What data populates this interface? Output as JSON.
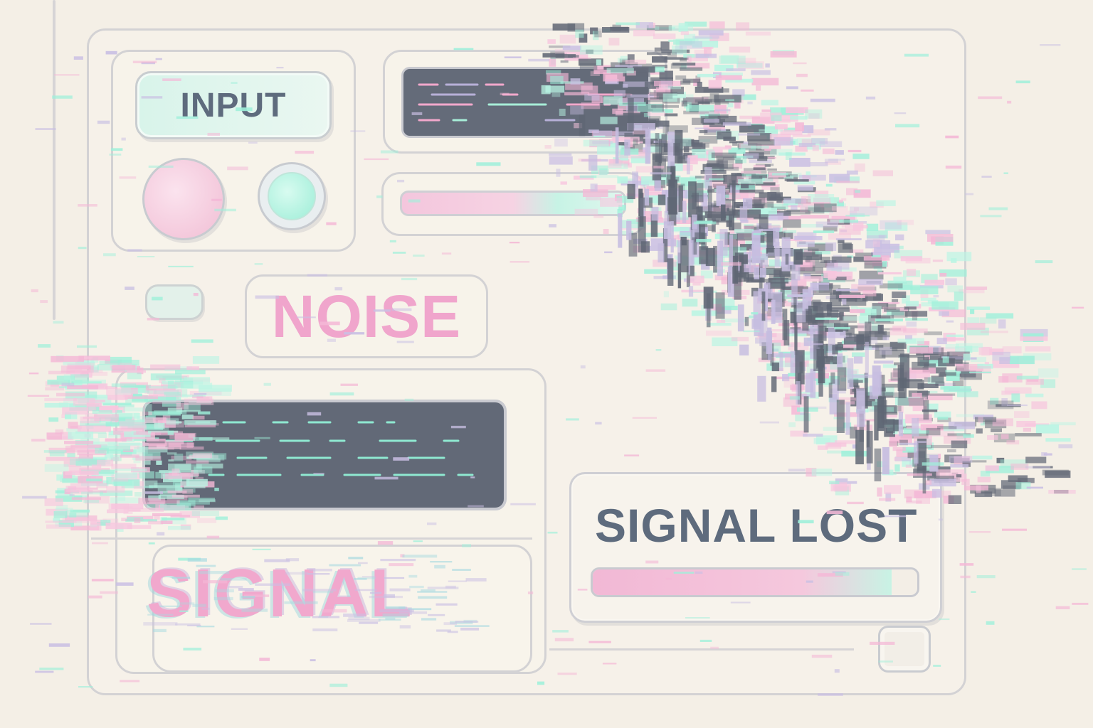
{
  "panel": {
    "input_label": "INPUT",
    "noise_label": "NOISE",
    "signal_label": "SIGNAL",
    "status_label": "SIGNAL LOST"
  },
  "status": {
    "progress_fraction": 0.92
  },
  "colors": {
    "background": "#f4efe6",
    "pink": "#f0a5cc",
    "mint": "#aef0dc",
    "slate": "#5e6b7d",
    "screen": "#646b79"
  },
  "icons": {
    "pink_knob": "circle-button",
    "mint_knob": "circle-button",
    "toggle": "pill-switch",
    "checkbox": "square-checkbox"
  }
}
